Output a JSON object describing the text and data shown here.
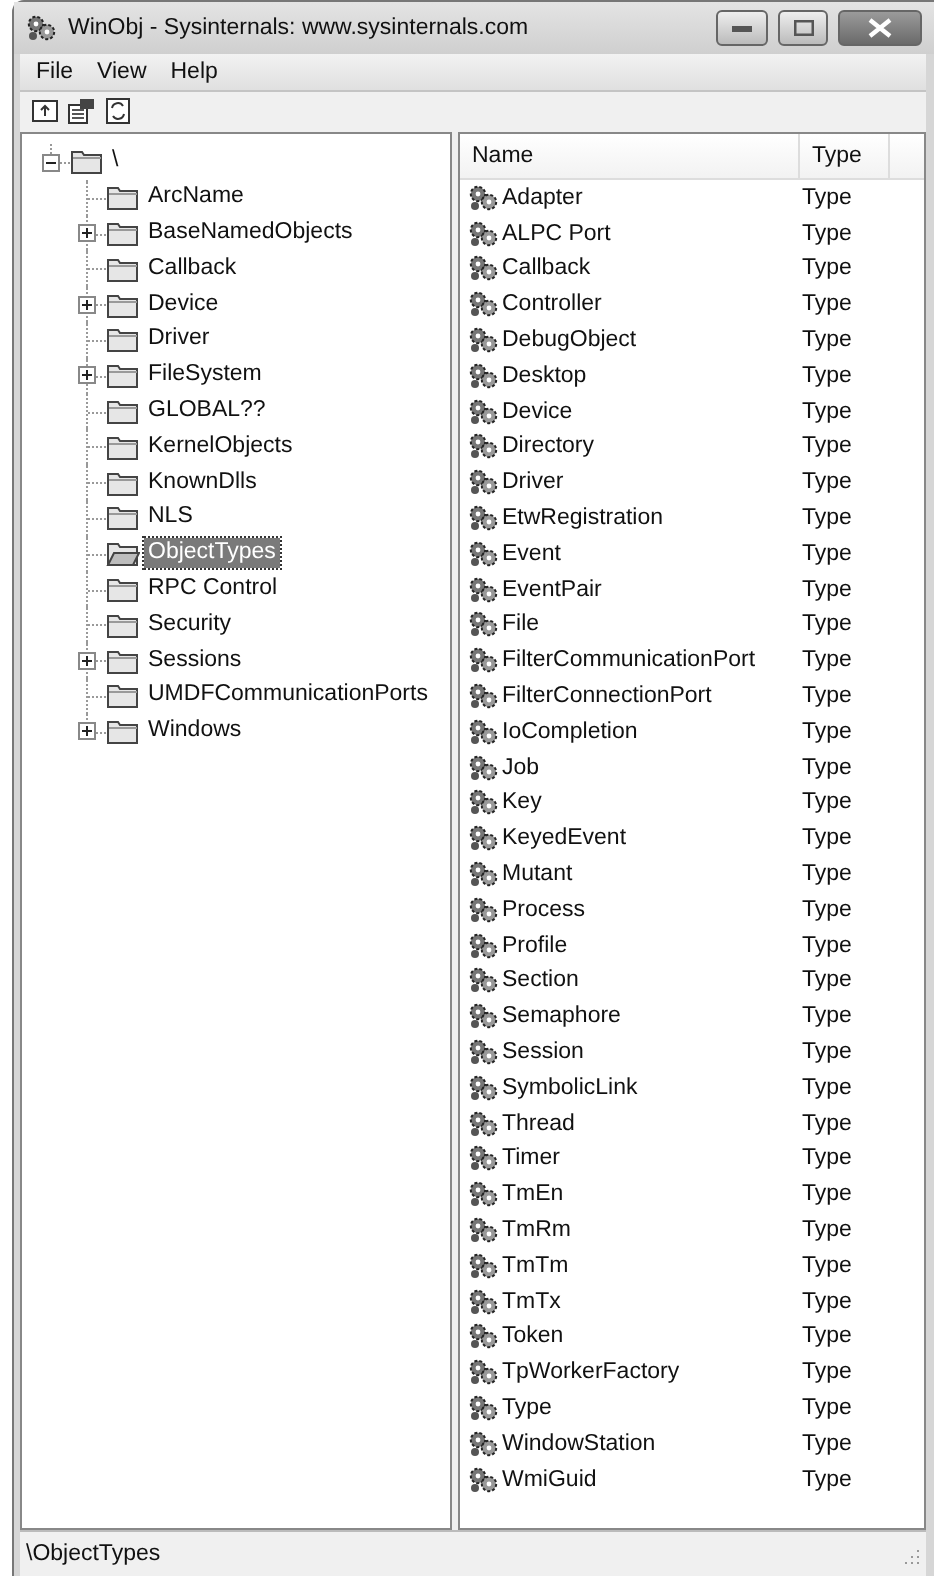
{
  "window": {
    "title": "WinObj - Sysinternals: www.sysinternals.com"
  },
  "menu": [
    "File",
    "View",
    "Help"
  ],
  "tree": {
    "label": "\\",
    "expanded": true,
    "selected": false,
    "children": [
      {
        "label": "ArcName",
        "selected": false
      },
      {
        "label": "BaseNamedObjects",
        "selected": false,
        "expanded": false
      },
      {
        "label": "Callback",
        "selected": false
      },
      {
        "label": "Device",
        "selected": false,
        "expanded": false
      },
      {
        "label": "Driver",
        "selected": false
      },
      {
        "label": "FileSystem",
        "selected": false,
        "expanded": false
      },
      {
        "label": "GLOBAL??",
        "selected": false
      },
      {
        "label": "KernelObjects",
        "selected": false
      },
      {
        "label": "KnownDlls",
        "selected": false
      },
      {
        "label": "NLS",
        "selected": false
      },
      {
        "label": "ObjectTypes",
        "selected": true
      },
      {
        "label": "RPC Control",
        "selected": false
      },
      {
        "label": "Security",
        "selected": false
      },
      {
        "label": "Sessions",
        "selected": false,
        "expanded": false
      },
      {
        "label": "UMDFCommunicationPorts",
        "selected": false
      },
      {
        "label": "Windows",
        "selected": false,
        "expanded": false
      }
    ]
  },
  "table": {
    "columns": [
      "Name",
      "Type"
    ],
    "rows": [
      [
        "Adapter",
        "Type"
      ],
      [
        "ALPC Port",
        "Type"
      ],
      [
        "Callback",
        "Type"
      ],
      [
        "Controller",
        "Type"
      ],
      [
        "DebugObject",
        "Type"
      ],
      [
        "Desktop",
        "Type"
      ],
      [
        "Device",
        "Type"
      ],
      [
        "Directory",
        "Type"
      ],
      [
        "Driver",
        "Type"
      ],
      [
        "EtwRegistration",
        "Type"
      ],
      [
        "Event",
        "Type"
      ],
      [
        "EventPair",
        "Type"
      ],
      [
        "File",
        "Type"
      ],
      [
        "FilterCommunicationPort",
        "Type"
      ],
      [
        "FilterConnectionPort",
        "Type"
      ],
      [
        "IoCompletion",
        "Type"
      ],
      [
        "Job",
        "Type"
      ],
      [
        "Key",
        "Type"
      ],
      [
        "KeyedEvent",
        "Type"
      ],
      [
        "Mutant",
        "Type"
      ],
      [
        "Process",
        "Type"
      ],
      [
        "Profile",
        "Type"
      ],
      [
        "Section",
        "Type"
      ],
      [
        "Semaphore",
        "Type"
      ],
      [
        "Session",
        "Type"
      ],
      [
        "SymbolicLink",
        "Type"
      ],
      [
        "Thread",
        "Type"
      ],
      [
        "Timer",
        "Type"
      ],
      [
        "TmEn",
        "Type"
      ],
      [
        "TmRm",
        "Type"
      ],
      [
        "TmTm",
        "Type"
      ],
      [
        "TmTx",
        "Type"
      ],
      [
        "Token",
        "Type"
      ],
      [
        "TpWorkerFactory",
        "Type"
      ],
      [
        "Type",
        "Type"
      ],
      [
        "WindowStation",
        "Type"
      ],
      [
        "WmiGuid",
        "Type"
      ]
    ]
  },
  "status_bar": "\\ObjectTypes"
}
